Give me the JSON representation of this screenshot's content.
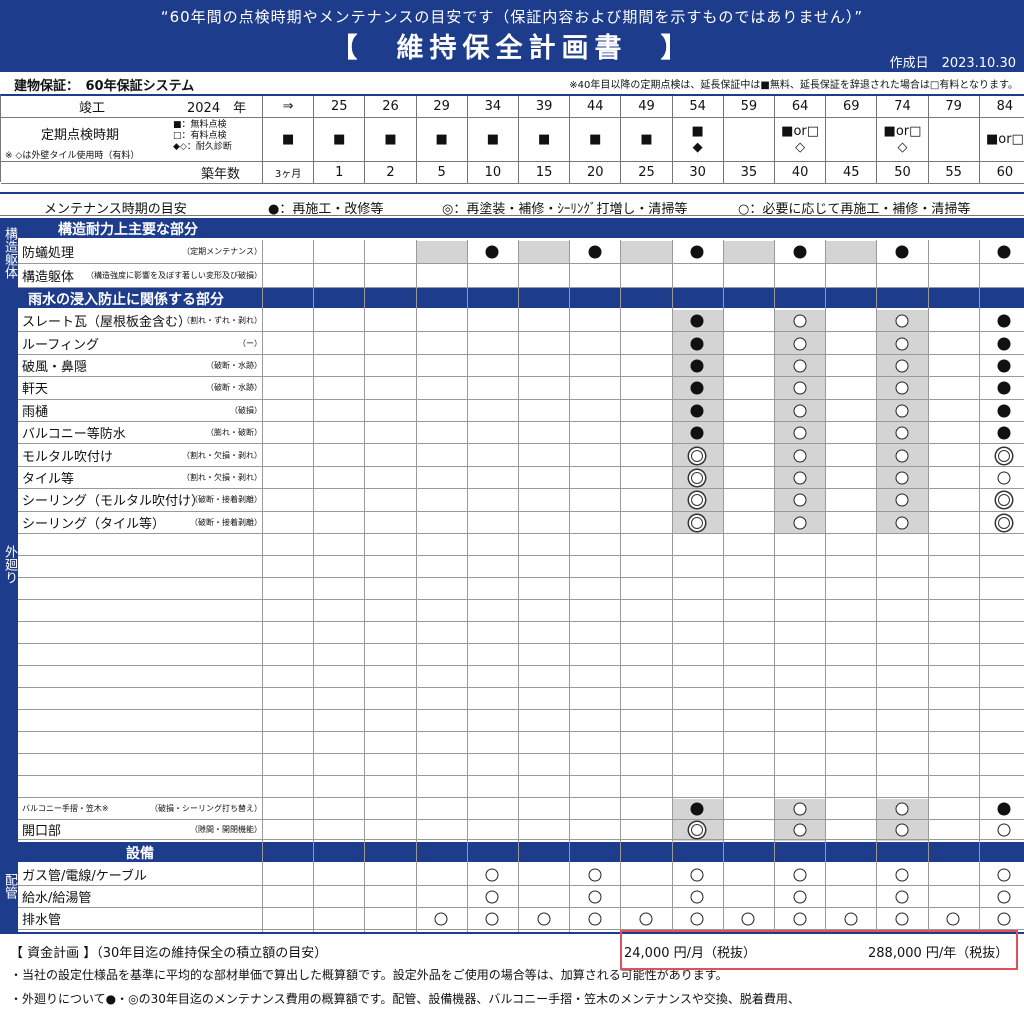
{
  "header": {
    "subtitle": "“60年間の点検時期やメンテナンスの目安です（保証内容および期間を示すものではありません）”",
    "title": "【　維持保全計画書　】",
    "created": "作成日　2023.10.30"
  },
  "info": {
    "warranty": "建物保証：　60年保証システム",
    "note": "※40年目以降の定期点検は、延長保証中は■無料、延長保証を辞退された場合は□有料となります。"
  },
  "schedule": {
    "completion_label": "竣工",
    "completion_year": "2024　年",
    "arrow": "⇒",
    "years": [
      "25",
      "26",
      "29",
      "34",
      "39",
      "44",
      "49",
      "54",
      "59",
      "64",
      "69",
      "74",
      "79",
      "84"
    ],
    "inspection_label": "定期点検時期",
    "inspection_legend": [
      "■：無料点検",
      "□：有料点検",
      "◆◇：耐久診断"
    ],
    "inspection_note": "※ ◇は外壁タイル使用時（有料）",
    "inspection_marks": [
      "■",
      "■",
      "■",
      "■",
      "■",
      "■",
      "■",
      "■\n◆",
      "",
      "■or□\n◇",
      "",
      "■or□\n◇",
      "",
      "■or□"
    ],
    "age_label": "築年数",
    "ages": [
      "3ヶ月",
      "1",
      "2",
      "5",
      "10",
      "15",
      "20",
      "25",
      "30",
      "35",
      "40",
      "45",
      "50",
      "55",
      "60"
    ]
  },
  "legend": {
    "label": "メンテナンス時期の目安",
    "filled": "●：再施工・改修等",
    "double": "◎：再塗装・補修・ｼｰﾘﾝｸﾞ打増し・清掃等",
    "open": "○：必要に応じて再施工・補修・清掃等"
  },
  "side_labels": {
    "structure": "構造躯体",
    "exterior": "外廻り",
    "piping": "配管"
  },
  "sections": {
    "structure": "構造耐力上主要な部分",
    "rain": "雨水の浸入防止に関係する部分",
    "equipment": "設備"
  },
  "rows": {
    "structure": [
      {
        "label": "防蟻処理",
        "note": "（定期メンテナンス）"
      },
      {
        "label": "構造躯体",
        "note": "（構造強度に影響を及ぼす著しい変形及び破損）"
      }
    ],
    "rain": [
      {
        "label": "スレート瓦（屋根板金含む）",
        "note": "（割れ・ずれ・剥れ）"
      },
      {
        "label": "ルーフィング",
        "note": "（ー）"
      },
      {
        "label": "破風・鼻隠",
        "note": "（破断・水跡）"
      },
      {
        "label": "軒天",
        "note": "（破断・水跡）"
      },
      {
        "label": "雨樋",
        "note": "（破損）"
      },
      {
        "label": "バルコニー等防水",
        "note": "（膨れ・破断）"
      },
      {
        "label": "モルタル吹付け",
        "note": "（割れ・欠損・剥れ）"
      },
      {
        "label": "タイル等",
        "note": "（割れ・欠損・剥れ）"
      },
      {
        "label": "シーリング（モルタル吹付け）",
        "note": "（破断・接着剥離）"
      },
      {
        "label": "シーリング（タイル等）",
        "note": "（破断・接着剥離）"
      }
    ],
    "balcony": [
      {
        "label": "バルコニー手摺・笠木※",
        "note": "（破損・シーリング打ち替え）"
      },
      {
        "label": "開口部",
        "note": "（隙間・開閉機能）"
      }
    ],
    "equipment": [
      {
        "label": "ガス管/電線/ケーブル",
        "note": ""
      },
      {
        "label": "給水/給湯管",
        "note": ""
      },
      {
        "label": "排水管",
        "note": ""
      }
    ]
  },
  "footer": {
    "funding": "【 資金計画 】（30年目迄の維持保全の積立額の目安）",
    "monthly": "24,000 円/月（税抜）",
    "yearly": "288,000 円/年（税抜）",
    "note1": "・当社の設定仕様品を基準に平均的な部材単価で算出した概算額です。設定外品をご使用の場合等は、加算される可能性があります。",
    "note2": "・外廻りについて●・◎の30年目迄のメンテナンス費用の概算額です。配管、設備機器、バルコニー手摺・笠木のメンテナンスや交換、脱着費用、"
  },
  "colors": {
    "navy": "#1e3c8c",
    "shade": "#d4d4d4",
    "highlight": "#e0505a"
  }
}
